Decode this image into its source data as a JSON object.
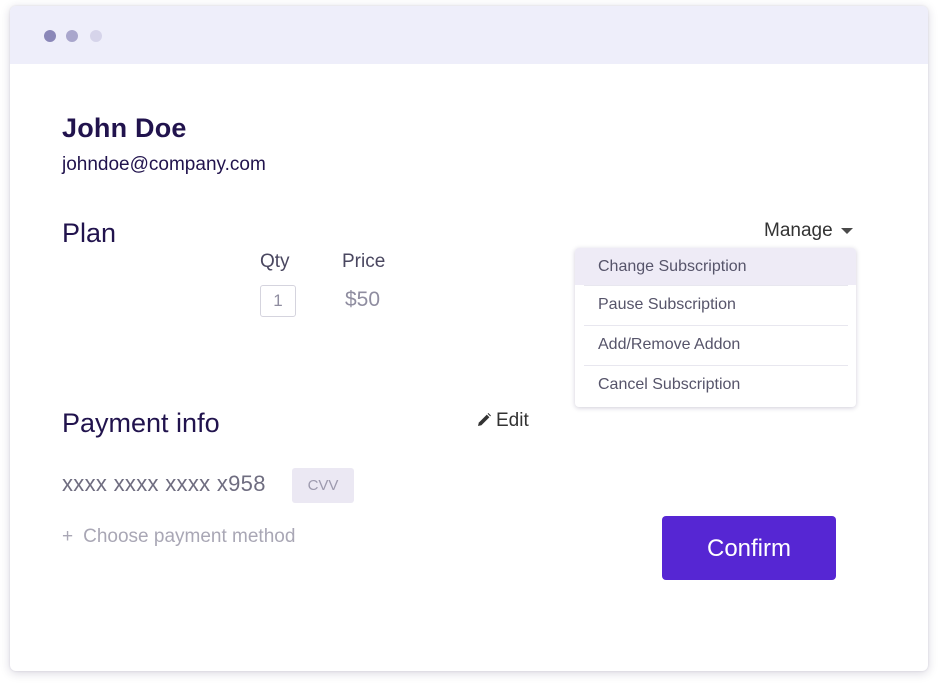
{
  "user": {
    "name": "John Doe",
    "email": "johndoe@company.com"
  },
  "plan": {
    "title": "Plan",
    "qty_label": "Qty",
    "price_label": "Price",
    "qty_value": "1",
    "price_value": "$50"
  },
  "manage_menu": {
    "label": "Manage",
    "items": [
      {
        "label": "Change Subscription",
        "active": true
      },
      {
        "label": "Pause Subscription"
      },
      {
        "label": "Add/Remove Addon"
      },
      {
        "label": "Cancel Subscription"
      }
    ]
  },
  "payment": {
    "title": "Payment info",
    "edit_label": "Edit",
    "card_number": "xxxx xxxx xxxx x958",
    "cvv_placeholder": "CVV",
    "choose_method": "Choose payment method"
  },
  "actions": {
    "confirm_label": "Confirm"
  },
  "colors": {
    "accent": "#5626d3",
    "heading": "#21134d",
    "titlebar": "#eeeefa"
  },
  "icons": {
    "edit": "pencil-icon",
    "manage": "caret-down-icon",
    "choose": "plus-icon"
  }
}
